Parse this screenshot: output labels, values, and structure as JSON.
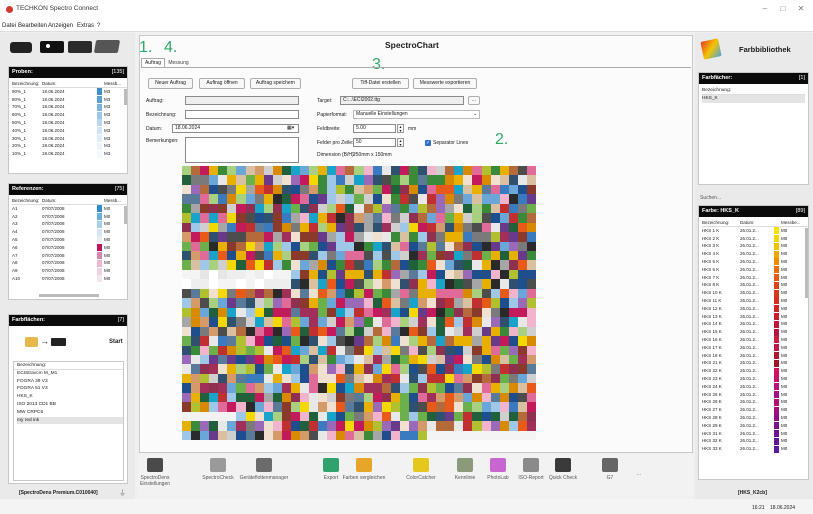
{
  "window": {
    "title": "TECHKON Spectro Connect"
  },
  "menu": [
    "Datei",
    "Bearbeiten",
    "Anzeigen",
    "Extras",
    "?"
  ],
  "left": {
    "proben": {
      "title": "Proben:",
      "count": "[135]",
      "headers": [
        "Bezeichnung:",
        "Datum:",
        "Messb..."
      ],
      "rows": [
        [
          "90%_1",
          "18.06.2024",
          "M3"
        ],
        [
          "80%_1",
          "18.06.2024",
          "M3"
        ],
        [
          "70%_1",
          "18.06.2024",
          "M3"
        ],
        [
          "60%_1",
          "18.06.2024",
          "M3"
        ],
        [
          "50%_1",
          "18.06.2024",
          "M3"
        ],
        [
          "40%_1",
          "18.06.2024",
          "M3"
        ],
        [
          "30%_1",
          "18.06.2024",
          "M3"
        ],
        [
          "20%_1",
          "18.06.2024",
          "M3"
        ],
        [
          "10%_1",
          "18.06.2024",
          "M3"
        ]
      ],
      "colors": [
        "#3d8ec9",
        "#5aa0d4",
        "#79b4df",
        "#9bc7e8",
        "#b7d7ef",
        "#cfe4f4",
        "#dfedf8",
        "#eaf3fa",
        "#f3f8fc"
      ]
    },
    "referenzen": {
      "title": "Referenzen:",
      "count": "[75]",
      "headers": [
        "Bezeichnung:",
        "Datum:",
        "Messb..."
      ],
      "rows": [
        [
          "A1",
          "07/07/2008",
          "M0"
        ],
        [
          "A2",
          "07/07/2008",
          "M0"
        ],
        [
          "A3",
          "07/07/2008",
          "M0"
        ],
        [
          "A4",
          "07/07/2008",
          "M0"
        ],
        [
          "A5",
          "07/07/2008",
          "M0"
        ],
        [
          "A6",
          "07/07/2008",
          "M0"
        ],
        [
          "A7",
          "07/07/2008",
          "M0"
        ],
        [
          "A8",
          "07/07/2008",
          "M0"
        ],
        [
          "A9",
          "07/07/2008",
          "M0"
        ],
        [
          "A10",
          "07/07/2008",
          "M0"
        ]
      ],
      "colors": [
        "#2f8ccf",
        "#6ab0df",
        "#a6cfec",
        "#d6e6f2",
        "#e8eef2",
        "#c0135a",
        "#d886ad",
        "#eab8cf",
        "#f1d4e1",
        "#f6e7ee"
      ]
    },
    "farbflaechen": {
      "title": "Farbflächen:",
      "count": "[7]",
      "start": "Start",
      "list_header": "Bezeichnung:",
      "items": [
        "ECIStravcm M_M1",
        "FOGRA 39 V3",
        "FOGRA 51 V3",
        "HKS_K",
        "ISO 2013 CD1 BB",
        "MW CRPC6",
        "my red ink"
      ]
    },
    "device": "[SpectroDens Premium.C010040]"
  },
  "main": {
    "title": "SpectroChart",
    "tabs": [
      "Auftrag",
      "Messung"
    ],
    "buttons": {
      "new": "Neuer Auftrag",
      "open": "Auftrag öffnen",
      "save": "Auftrag speichern",
      "tiff": "Tiff-Datei erstellen",
      "export": "Messwerte exportieren"
    },
    "form": {
      "auftrag": "Auftrag:",
      "bezeichnung": "Bezeichnung:",
      "datum": "Datum:",
      "datum_value": "18.06.2024",
      "bemerkungen": "Bemerkungen:",
      "target": "Target:",
      "target_value": "C:...\\ECI2002.ttg",
      "browse": "...",
      "papierformat": "Papierformat:",
      "papierformat_value": "Manuelle Einstellungen",
      "feldbreite": "Feldbreite:",
      "feldbreite_value": "5.00",
      "feldbreite_unit": "mm",
      "felder": "Felder pro Zeile:",
      "felder_value": "50",
      "separator": "Separator Lines",
      "dimension": "Dimension (B/H):",
      "dimension_value": "250mm x 150mm"
    },
    "annotations": {
      "n1": "1.",
      "n4": "4.",
      "n3": "3.",
      "n2": "2."
    }
  },
  "toolbar": [
    {
      "label": "SpectroDens Einstellungen",
      "color": "#4a4a4a"
    },
    {
      "label": "SpectroCheck",
      "color": "#9a9a9a"
    },
    {
      "label": "Geräteflottenmanager",
      "color": "#6b6b6b"
    },
    {
      "label": "Export",
      "color": "#2fa36b"
    },
    {
      "label": "Farben vergleichen",
      "color": "#e7a62a"
    },
    {
      "label": "ColorCatcher",
      "color": "#e6c71e"
    },
    {
      "label": "Kennlinie",
      "color": "#8a9a7a"
    },
    {
      "label": "PhotoLab",
      "color": "#c765d1"
    },
    {
      "label": "ISO-Report",
      "color": "#8a8a8a"
    },
    {
      "label": "Quick Check",
      "color": "#3a3a3a"
    },
    {
      "label": "G7",
      "color": "#666666"
    },
    {
      "label": "...",
      "color": "#333333"
    }
  ],
  "right": {
    "title": "Farbbibliothek",
    "farbfaecher": {
      "title": "Farbfächer:",
      "count": "[1]",
      "header": "Bezeichnung:",
      "items": [
        "HKS_K"
      ]
    },
    "search": "Suchen...",
    "farbe": {
      "title": "Farbe: HKS_K",
      "count": "[89]",
      "headers": [
        "Bezeichnung:",
        "Datum:",
        "Messbe..."
      ],
      "rows": [
        [
          "HKS 1 K",
          "26.01.2...",
          "M0"
        ],
        [
          "HKS 2 K",
          "26.01.2...",
          "M0"
        ],
        [
          "HKS 3 K",
          "26.01.2...",
          "M0"
        ],
        [
          "HKS 4 K",
          "26.01.2...",
          "M0"
        ],
        [
          "HKS 5 K",
          "26.01.2...",
          "M0"
        ],
        [
          "HKS 6 K",
          "26.01.2...",
          "M0"
        ],
        [
          "HKS 7 K",
          "26.01.2...",
          "M0"
        ],
        [
          "HKS 8 K",
          "26.01.2...",
          "M0"
        ],
        [
          "HKS 10 K",
          "26.01.2...",
          "M0"
        ],
        [
          "HKS 11 K",
          "26.01.2...",
          "M0"
        ],
        [
          "HKS 12 K",
          "26.01.2...",
          "M0"
        ],
        [
          "HKS 13 K",
          "26.01.2...",
          "M0"
        ],
        [
          "HKS 14 K",
          "26.01.2...",
          "M0"
        ],
        [
          "HKS 15 K",
          "26.01.2...",
          "M0"
        ],
        [
          "HKS 16 K",
          "26.01.2...",
          "M0"
        ],
        [
          "HKS 17 K",
          "26.01.2...",
          "M0"
        ],
        [
          "HKS 18 K",
          "26.01.2...",
          "M0"
        ],
        [
          "HKS 21 K",
          "26.01.2...",
          "M0"
        ],
        [
          "HKS 22 K",
          "26.01.2...",
          "M0"
        ],
        [
          "HKS 23 K",
          "26.01.2...",
          "M0"
        ],
        [
          "HKS 24 K",
          "26.01.2...",
          "M0"
        ],
        [
          "HKS 25 K",
          "26.01.2...",
          "M0"
        ],
        [
          "HKS 26 K",
          "26.01.2...",
          "M0"
        ],
        [
          "HKS 27 K",
          "26.01.2...",
          "M0"
        ],
        [
          "HKS 28 K",
          "26.01.2...",
          "M0"
        ],
        [
          "HKS 29 K",
          "26.01.2...",
          "M0"
        ],
        [
          "HKS 31 K",
          "26.01.2...",
          "M0"
        ],
        [
          "HKS 32 K",
          "26.01.2...",
          "M0"
        ],
        [
          "HKS 33 K",
          "26.01.2...",
          "M0"
        ]
      ],
      "colors": [
        "#f5e400",
        "#f3d800",
        "#f2c200",
        "#f0a800",
        "#ee8c00",
        "#e96d00",
        "#e45a10",
        "#dd4718",
        "#d8381c",
        "#d43020",
        "#cf2427",
        "#c81d2d",
        "#c21834",
        "#b8153c",
        "#d11e3c",
        "#c01a4a",
        "#b01a2e",
        "#9c1a25",
        "#d4135d",
        "#c8116b",
        "#b80f7a",
        "#a40f85",
        "#b30f70",
        "#9f0f7d",
        "#8e1087",
        "#7e1190",
        "#6f1395",
        "#64169b",
        "#5b18a0"
      ]
    },
    "footer": "[HKS_K2cb]"
  },
  "status": {
    "time": "16:21",
    "date": "18.06.2024"
  }
}
